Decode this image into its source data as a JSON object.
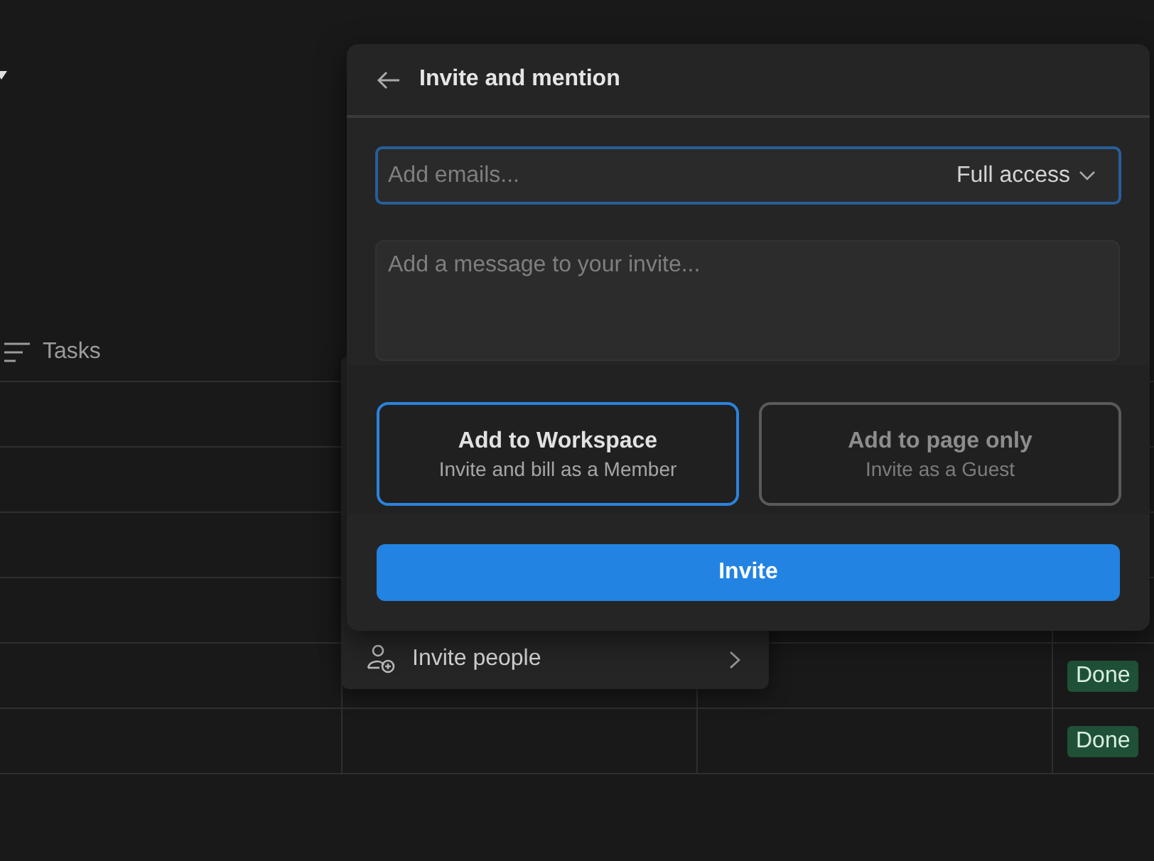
{
  "table": {
    "columns": [
      {
        "label": "Tasks"
      }
    ],
    "rows": [
      {},
      {},
      {},
      {},
      {
        "status": "Done"
      },
      {
        "status": "Done"
      }
    ]
  },
  "menu": {
    "items": [
      {
        "label": "Invite people"
      }
    ]
  },
  "invite_dialog": {
    "title": "Invite and mention",
    "email_field": {
      "placeholder": "Add emails..."
    },
    "access": {
      "label": "Full access"
    },
    "message_field": {
      "placeholder": "Add a message to your invite..."
    },
    "options": [
      {
        "title": "Add to Workspace",
        "subtitle": "Invite and bill as a Member",
        "selected": true
      },
      {
        "title": "Add to page only",
        "subtitle": "Invite as a Guest",
        "selected": false
      }
    ],
    "invite_button": {
      "label": "Invite"
    }
  }
}
